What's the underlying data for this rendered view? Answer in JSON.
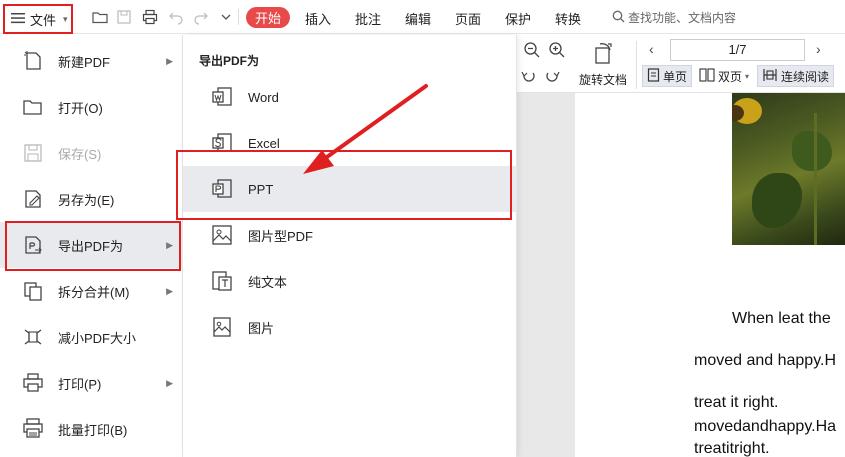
{
  "toolbar": {
    "file_label": "文件",
    "tabs": [
      "开始",
      "插入",
      "批注",
      "编辑",
      "页面",
      "保护",
      "转换"
    ],
    "search_label": "查找功能、文档内容"
  },
  "ribbon": {
    "rotate_label": "旋转文档",
    "page_indicator": "1/7",
    "single_page": "单页",
    "double_page": "双页",
    "continuous": "连续阅读"
  },
  "file_menu": {
    "items": [
      {
        "label": "新建PDF",
        "icon": "new-pdf-icon",
        "has_submenu": true
      },
      {
        "label": "打开(O)",
        "icon": "folder-open-icon",
        "has_submenu": false
      },
      {
        "label": "保存(S)",
        "icon": "save-icon",
        "has_submenu": false,
        "disabled": true
      },
      {
        "label": "另存为(E)",
        "icon": "save-as-icon",
        "has_submenu": false
      },
      {
        "label": "导出PDF为",
        "icon": "export-pdf-icon",
        "has_submenu": true,
        "selected": true
      },
      {
        "label": "拆分合并(M)",
        "icon": "split-merge-icon",
        "has_submenu": true
      },
      {
        "label": "减小PDF大小",
        "icon": "compress-icon",
        "has_submenu": false
      },
      {
        "label": "打印(P)",
        "icon": "print-icon",
        "has_submenu": true
      },
      {
        "label": "批量打印(B)",
        "icon": "batch-print-icon",
        "has_submenu": false
      }
    ]
  },
  "export_submenu": {
    "title": "导出PDF为",
    "items": [
      {
        "label": "Word",
        "icon": "word-icon"
      },
      {
        "label": "Excel",
        "icon": "excel-icon"
      },
      {
        "label": "PPT",
        "icon": "ppt-icon",
        "selected": true
      },
      {
        "label": "图片型PDF",
        "icon": "image-pdf-icon"
      },
      {
        "label": "纯文本",
        "icon": "plain-text-icon"
      },
      {
        "label": "图片",
        "icon": "image-icon"
      }
    ]
  },
  "document": {
    "lines": [
      "When leat the",
      "moved and happy.H",
      "treat it right.",
      "movedandhappy.Ha",
      "treatitright."
    ]
  },
  "colors": {
    "accent_red": "#e84a4a",
    "annotation_red": "#e02020",
    "menu_selected_bg": "#e8eaee"
  }
}
